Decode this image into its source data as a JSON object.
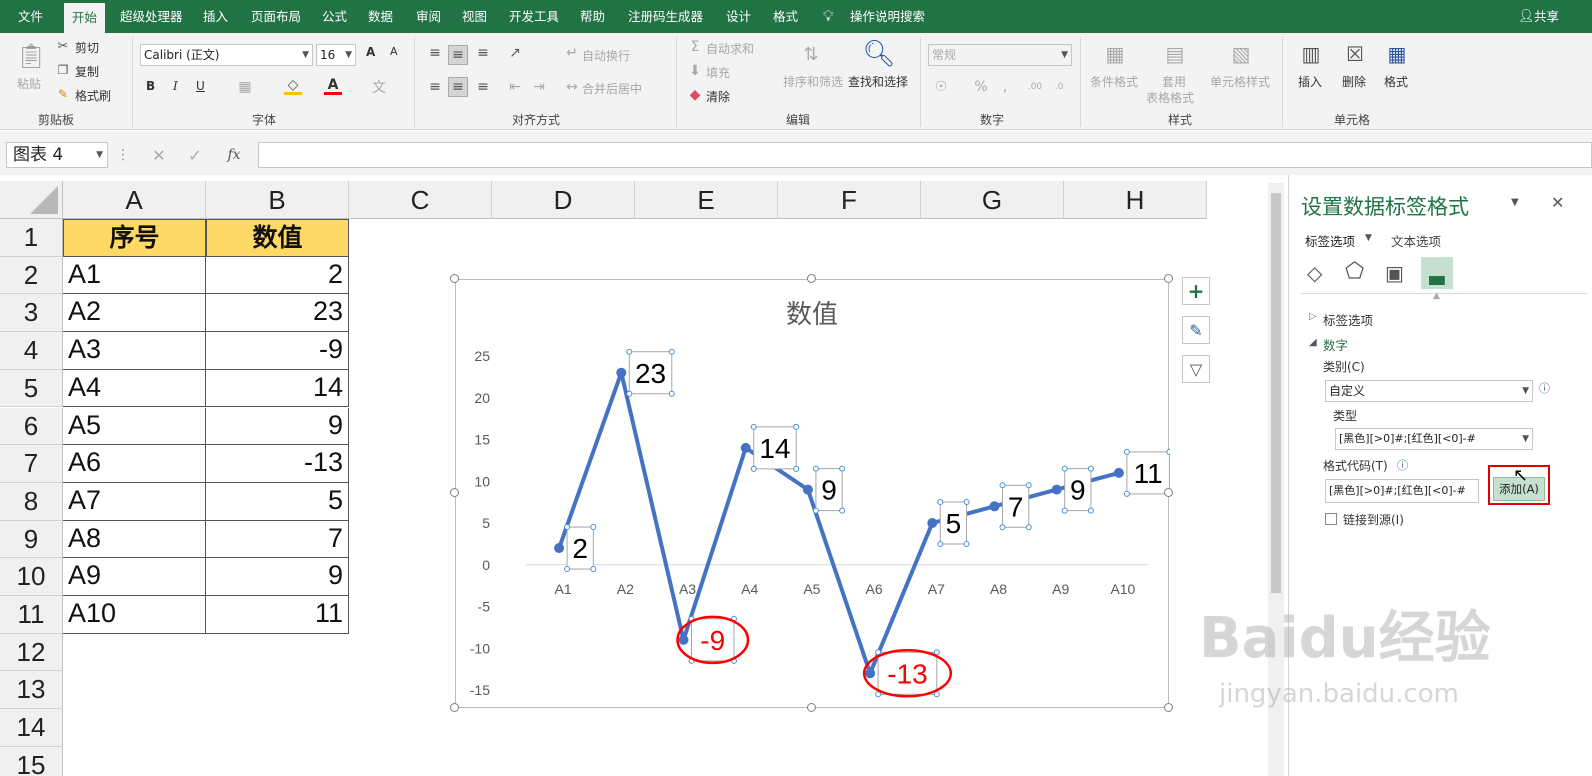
{
  "menu": {
    "file": "文件",
    "tabs": [
      "开始",
      "超级处理器",
      "插入",
      "页面布局",
      "公式",
      "数据",
      "审阅",
      "视图",
      "开发工具",
      "帮助",
      "注册码生成器",
      "设计",
      "格式"
    ],
    "search": "操作说明搜索",
    "share": "共享"
  },
  "ribbon": {
    "clipboard": {
      "paste": "粘贴",
      "cut": "剪切",
      "copy": "复制",
      "painter": "格式刷",
      "label": "剪贴板"
    },
    "font": {
      "name": "Calibri (正文)",
      "size": "16",
      "bold": "B",
      "italic": "I",
      "underline": "U",
      "grow": "A",
      "shrink": "A",
      "label": "字体"
    },
    "align": {
      "wrap": "自动换行",
      "merge": "合并后居中",
      "label": "对齐方式"
    },
    "edit": {
      "autosum": "自动求和",
      "fill": "填充",
      "clear": "清除",
      "sort": "排序和筛选",
      "find": "查找和选择",
      "label": "编辑"
    },
    "number": {
      "format": "常规",
      "label": "数字"
    },
    "styles": {
      "cond": "条件格式",
      "table1": "套用",
      "table2": "表格格式",
      "cell": "单元格样式",
      "label": "样式"
    },
    "cells": {
      "insert": "插入",
      "delete": "删除",
      "format": "格式",
      "label": "单元格"
    }
  },
  "formula": {
    "namebox": "图表 4",
    "fx": "fx"
  },
  "sheet": {
    "columns": [
      "A",
      "B",
      "C",
      "D",
      "E",
      "F",
      "G",
      "H"
    ],
    "rows": [
      "1",
      "2",
      "3",
      "4",
      "5",
      "6",
      "7",
      "8",
      "9",
      "10",
      "11",
      "12",
      "13",
      "14",
      "15"
    ],
    "header": {
      "a": "序号",
      "b": "数值"
    },
    "data": [
      [
        "A1",
        "2"
      ],
      [
        "A2",
        "23"
      ],
      [
        "A3",
        "-9"
      ],
      [
        "A4",
        "14"
      ],
      [
        "A5",
        "9"
      ],
      [
        "A6",
        "-13"
      ],
      [
        "A7",
        "5"
      ],
      [
        "A8",
        "7"
      ],
      [
        "A9",
        "9"
      ],
      [
        "A10",
        "11"
      ]
    ]
  },
  "chart_data": {
    "type": "line",
    "title": "数值",
    "categories": [
      "A1",
      "A2",
      "A3",
      "A4",
      "A5",
      "A6",
      "A7",
      "A8",
      "A9",
      "A10"
    ],
    "series": [
      {
        "name": "数值",
        "values": [
          2,
          23,
          -9,
          14,
          9,
          -13,
          5,
          7,
          9,
          11
        ],
        "color": "#4472c4"
      }
    ],
    "yticks": [
      "25",
      "20",
      "15",
      "10",
      "5",
      "0",
      "-5",
      "-10",
      "-15"
    ],
    "ylim": [
      -15,
      25
    ],
    "labels": [
      "2",
      "23",
      "-9",
      "14",
      "9",
      "-13",
      "5",
      "7",
      "9",
      "11"
    ],
    "negative_label_color": "#ff0000",
    "positive_label_color": "#000000",
    "grid": false,
    "legend": "none"
  },
  "pane": {
    "title": "设置数据标签格式",
    "tab_label_options": "标签选项",
    "tab_text_options": "文本选项",
    "section_label": "标签选项",
    "section_number": "数字",
    "category_label": "类别(C)",
    "category_value": "自定义",
    "type_label": "类型",
    "type_value": "[黑色][>0]#;[红色][<0]-#",
    "format_code_label": "格式代码(T)",
    "format_code_value": "[黑色][>0]#;[红色][<0]-#",
    "add_button": "添加(A)",
    "link_source": "链接到源(I)"
  },
  "watermark": {
    "brand": "Baidu经验",
    "url": "jingyan.baidu.com"
  },
  "colors": {
    "accent": "#217346",
    "highlight": "#ff0000",
    "header_fill": "#ffd966",
    "series": "#4472c4"
  }
}
